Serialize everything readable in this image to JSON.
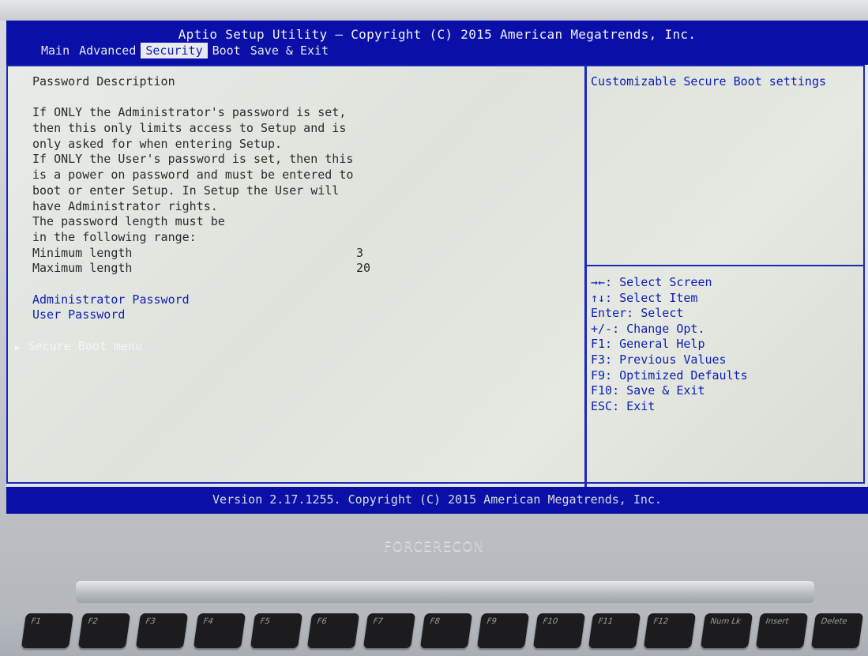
{
  "header": {
    "title": "Aptio Setup Utility – Copyright (C) 2015 American Megatrends, Inc."
  },
  "tabs": [
    {
      "label": "Main"
    },
    {
      "label": "Advanced"
    },
    {
      "label": "Security",
      "active": true
    },
    {
      "label": "Boot"
    },
    {
      "label": "Save & Exit"
    }
  ],
  "main": {
    "heading": "Password Description",
    "description_lines": [
      "If ONLY the Administrator's password is set,",
      "then this only limits access to Setup and is",
      "only asked for when entering Setup.",
      "If ONLY the User's password is set, then this",
      "is a power on password and must be entered to",
      "boot or enter Setup. In Setup the User will",
      "have Administrator rights.",
      "The password length must be",
      "in the following range:"
    ],
    "min_label": "Minimum length",
    "min_value": "3",
    "max_label": "Maximum length",
    "max_value": "20",
    "admin_password": "Administrator Password",
    "user_password": "User Password",
    "secure_boot_menu": "Secure Boot menu"
  },
  "help": {
    "text": "Customizable Secure Boot settings"
  },
  "keys": [
    "→←: Select Screen",
    "↑↓: Select Item",
    "Enter: Select",
    "+/-: Change Opt.",
    "F1: General Help",
    "F3: Previous Values",
    "F9: Optimized Defaults",
    "F10: Save & Exit",
    "ESC: Exit"
  ],
  "footer": {
    "version": "Version 2.17.1255. Copyright (C) 2015 American Megatrends, Inc."
  },
  "laptop": {
    "brand": "FORCERECON"
  },
  "keyboard": {
    "keys": [
      {
        "label": "F1"
      },
      {
        "label": "F2"
      },
      {
        "label": "F3"
      },
      {
        "label": "F4"
      },
      {
        "label": "F5"
      },
      {
        "label": "F6"
      },
      {
        "label": "F7"
      },
      {
        "label": "F8"
      },
      {
        "label": "F9"
      },
      {
        "label": "F10"
      },
      {
        "label": "F11"
      },
      {
        "label": "F12"
      },
      {
        "label": "Num Lk"
      },
      {
        "label": "Insert"
      },
      {
        "label": "Delete"
      }
    ]
  },
  "colors": {
    "bios_blue": "#0a0fa8",
    "panel_bg": "#e3e6df",
    "link_blue": "#0b1fb3",
    "text_dark": "#2b2b2b"
  }
}
